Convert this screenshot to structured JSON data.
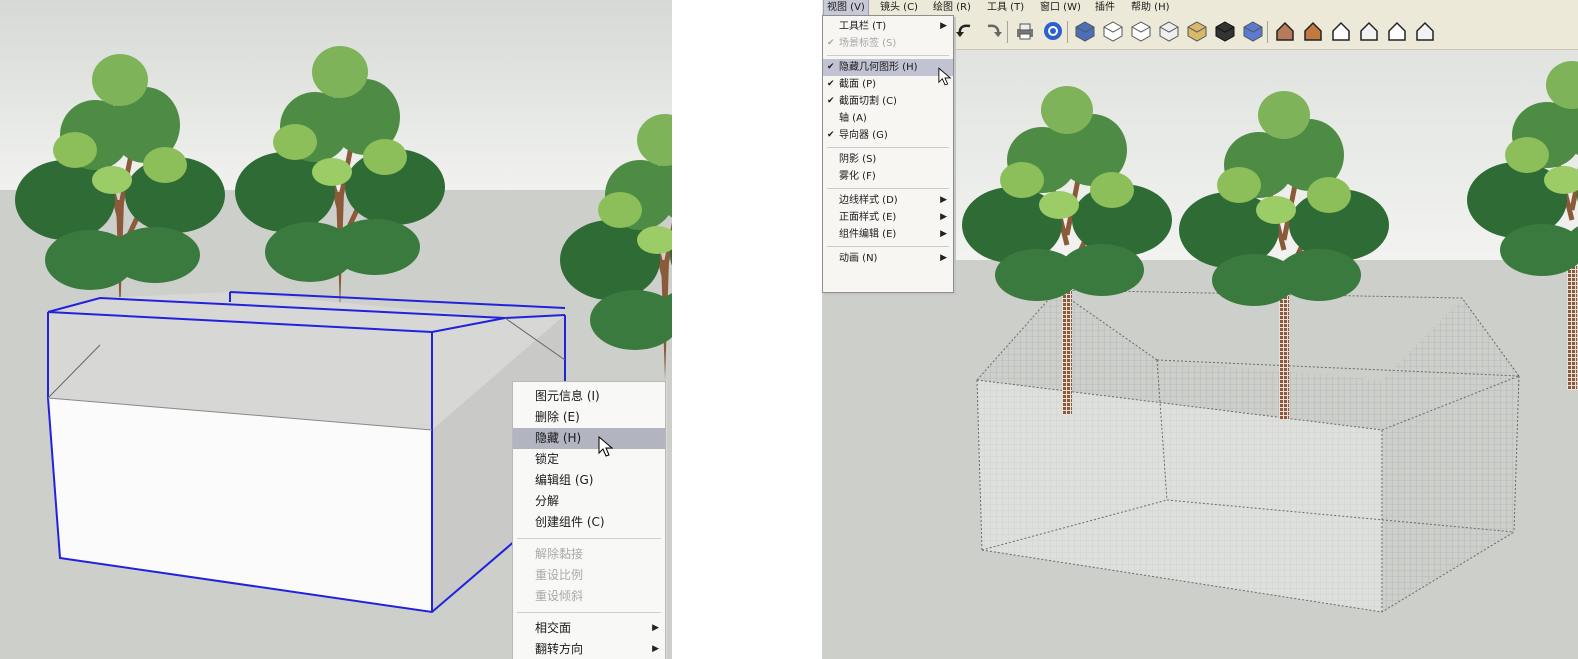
{
  "left": {
    "context_menu": {
      "items": [
        {
          "label": "图元信息 (I)",
          "state": "normal"
        },
        {
          "label": "删除 (E)",
          "state": "normal"
        },
        {
          "label": "隐藏 (H)",
          "state": "highlighted"
        },
        {
          "label": "锁定",
          "state": "normal"
        },
        {
          "label": "编辑组 (G)",
          "state": "normal"
        },
        {
          "label": "分解",
          "state": "normal"
        },
        {
          "label": "创建组件 (C)",
          "state": "normal"
        },
        {
          "label": "解除黏接",
          "state": "disabled"
        },
        {
          "label": "重设比例",
          "state": "disabled"
        },
        {
          "label": "重设倾斜",
          "state": "disabled"
        },
        {
          "label": "相交面",
          "state": "normal",
          "submenu": true
        },
        {
          "label": "翻转方向",
          "state": "normal",
          "submenu": true
        }
      ]
    }
  },
  "right": {
    "menubar": [
      "视图 (V)",
      "镜头 (C)",
      "绘图 (R)",
      "工具 (T)",
      "窗口 (W)",
      "插件",
      "帮助 (H)"
    ],
    "view_menu": {
      "items": [
        {
          "label": "工具栏 (T)",
          "checked": false,
          "submenu": true,
          "state": "normal"
        },
        {
          "label": "场景标签 (S)",
          "checked": true,
          "submenu": false,
          "state": "disabled"
        },
        {
          "label": "隐藏几何图形 (H)",
          "checked": true,
          "submenu": false,
          "state": "highlighted"
        },
        {
          "label": "截面 (P)",
          "checked": true,
          "submenu": false,
          "state": "normal"
        },
        {
          "label": "截面切割 (C)",
          "checked": true,
          "submenu": false,
          "state": "normal"
        },
        {
          "label": "轴 (A)",
          "checked": false,
          "submenu": false,
          "state": "normal"
        },
        {
          "label": "导向器 (G)",
          "checked": true,
          "submenu": false,
          "state": "normal"
        },
        {
          "label": "阴影 (S)",
          "checked": false,
          "submenu": false,
          "state": "normal"
        },
        {
          "label": "雾化 (F)",
          "checked": false,
          "submenu": false,
          "state": "normal"
        },
        {
          "label": "边线样式 (D)",
          "checked": false,
          "submenu": true,
          "state": "normal"
        },
        {
          "label": "正面样式 (E)",
          "checked": false,
          "submenu": true,
          "state": "normal"
        },
        {
          "label": "组件编辑 (E)",
          "checked": false,
          "submenu": true,
          "state": "normal"
        },
        {
          "label": "动画 (N)",
          "checked": false,
          "submenu": true,
          "state": "normal"
        }
      ]
    },
    "toolbar_icons": [
      "undo-icon",
      "redo-icon",
      "print-icon",
      "model-info-icon",
      "iso-view-icon",
      "wireframe-icon",
      "hidden-line-icon",
      "shaded-icon",
      "shaded-texture-icon",
      "monochrome-icon",
      "xray-icon",
      "top-view-icon",
      "front-view-icon",
      "right-view-icon",
      "back-view-icon",
      "left-view-icon",
      "bottom-view-icon"
    ]
  },
  "colors": {
    "sky_top": "#d9dcd8",
    "ground": "#cdcfcb",
    "selection_blue": "#2222dd",
    "foliage_dark": "#2f6b35",
    "foliage_light": "#8cbf5a",
    "trunk": "#8a5a3a",
    "menu_highlight": "#b2b4c0"
  }
}
